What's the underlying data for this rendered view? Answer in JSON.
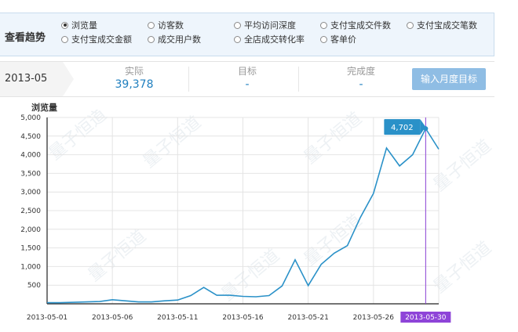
{
  "trend": {
    "title": "查看趋势",
    "options": [
      {
        "label": "浏览量",
        "selected": true
      },
      {
        "label": "访客数",
        "selected": false
      },
      {
        "label": "平均访问深度",
        "selected": false
      },
      {
        "label": "支付宝成交件数",
        "selected": false
      },
      {
        "label": "支付宝成交笔数",
        "selected": false
      },
      {
        "label": "支付宝成交金额",
        "selected": false
      },
      {
        "label": "成交用户数",
        "selected": false
      },
      {
        "label": "全店成交转化率",
        "selected": false
      },
      {
        "label": "客单价",
        "selected": false
      }
    ]
  },
  "month": {
    "label": "2013-05",
    "actual_label": "实际",
    "actual_value": "39,378",
    "target_label": "目标",
    "target_value": "-",
    "completion_label": "完成度",
    "completion_value": "-",
    "input_target_button": "输入月度目标"
  },
  "chart_data": {
    "type": "line",
    "ylabel": "浏览量",
    "ylim": [
      0,
      5000
    ],
    "yticks": [
      "500",
      "1,000",
      "1,500",
      "2,000",
      "2,500",
      "3,000",
      "3,500",
      "4,000",
      "4,500",
      "5,000"
    ],
    "xtick_labels": [
      "2013-05-01",
      "2013-05-06",
      "2013-05-11",
      "2013-05-16",
      "2013-05-21",
      "2013-05-26",
      "2013-05-30"
    ],
    "x": [
      "2013-05-01",
      "2013-05-02",
      "2013-05-03",
      "2013-05-04",
      "2013-05-05",
      "2013-05-06",
      "2013-05-07",
      "2013-05-08",
      "2013-05-09",
      "2013-05-10",
      "2013-05-11",
      "2013-05-12",
      "2013-05-13",
      "2013-05-14",
      "2013-05-15",
      "2013-05-16",
      "2013-05-17",
      "2013-05-18",
      "2013-05-19",
      "2013-05-20",
      "2013-05-21",
      "2013-05-22",
      "2013-05-23",
      "2013-05-24",
      "2013-05-25",
      "2013-05-26",
      "2013-05-27",
      "2013-05-28",
      "2013-05-29",
      "2013-05-30",
      "2013-05-31"
    ],
    "values": [
      30,
      30,
      40,
      50,
      60,
      110,
      80,
      50,
      50,
      80,
      100,
      220,
      440,
      230,
      230,
      200,
      190,
      220,
      480,
      1180,
      490,
      1060,
      1360,
      1560,
      2320,
      2960,
      4180,
      3700,
      4000,
      4702,
      4150
    ],
    "highlight": {
      "date": "2013-05-30",
      "value_label": "4,702"
    },
    "line_color": "#2a91c8",
    "highlight_color": "#8e44d8",
    "tooltip_color": "#2a91c8"
  },
  "watermark": "量子恒道"
}
